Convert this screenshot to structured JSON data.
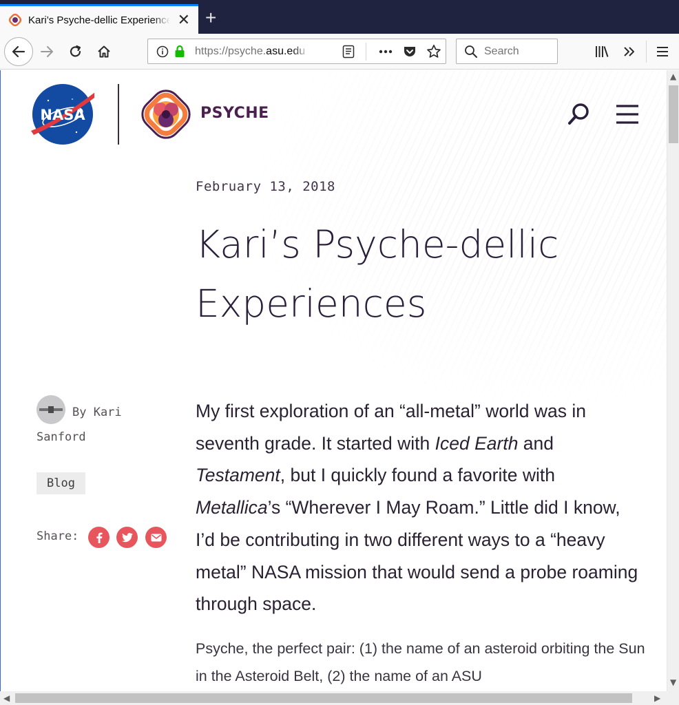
{
  "browser": {
    "tab": {
      "title": "Kari’s Psyche-dellic Experiences"
    },
    "url": {
      "prefix": "https://psyche.",
      "domain": "asu.edu"
    },
    "search": {
      "placeholder": "Search"
    }
  },
  "site": {
    "nasa_logo_text": "NASA",
    "psyche_brand": "PSYCHE"
  },
  "post": {
    "date": "February 13, 2018",
    "title": "Kari’s Psyche-dellic Experiences",
    "byline": "By Kari Sanford",
    "category": "Blog",
    "share_label": "Share:",
    "lead": {
      "s1": "My first exploration of an “all-metal” world was in seventh grade. It started with ",
      "i1": "Iced Earth",
      "s2": " and ",
      "i2": "Testament",
      "s3": ", but I quickly found a favorite with ",
      "i3": "Metallica",
      "s4": "’s “Wherever I May Roam.” Little did I know, I’d be contributing in two different ways to a “heavy metal” NASA mission that would send a probe roaming through space."
    },
    "paragraph": "Psyche, the perfect pair: (1) the name of an asteroid orbiting the Sun in the Asteroid Belt, (2) the name of an ASU"
  },
  "icons": {
    "share": [
      "facebook-icon",
      "twitter-icon",
      "email-icon"
    ]
  },
  "colors": {
    "share_accent": "#e8565d",
    "brand_purple": "#4b1f4f",
    "browser_tabbar": "#202340"
  }
}
